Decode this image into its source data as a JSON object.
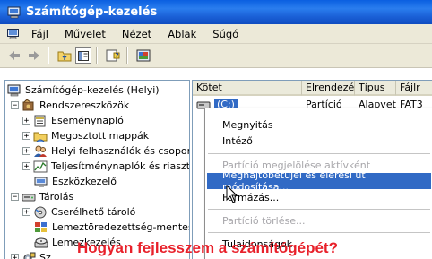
{
  "window": {
    "title": "Számítógép-kezelés"
  },
  "menubar": {
    "items": [
      "Fájl",
      "Művelet",
      "Nézet",
      "Ablak",
      "Súgó"
    ]
  },
  "toolbar": {
    "buttons": [
      "back-icon",
      "forward-icon",
      "up-folder-icon",
      "show-hide-tree-icon",
      "help-icon",
      "properties-icon"
    ]
  },
  "tree": {
    "root": "Számítógép-kezelés (Helyi)",
    "nodes": [
      {
        "label": "Rendszereszközök"
      },
      {
        "label": "Eseménynapló"
      },
      {
        "label": "Megosztott mappák"
      },
      {
        "label": "Helyi felhasználók és csoport"
      },
      {
        "label": "Teljesítménynaplók és riasztá"
      },
      {
        "label": "Eszközkezelő"
      },
      {
        "label": "Tárolás"
      },
      {
        "label": "Cserélhető tároló"
      },
      {
        "label": "Lemeztöredezettség-mentes"
      },
      {
        "label": "Lemezkezelés"
      },
      {
        "label": "Sz"
      }
    ]
  },
  "list": {
    "columns": [
      "Kötet",
      "Elrendezés",
      "Típus",
      "Fájlr"
    ],
    "rows": [
      {
        "volume": "(C:)",
        "layout": "Partíció",
        "type": "Alapvető",
        "fs": "FAT3"
      }
    ]
  },
  "context_menu": {
    "items": [
      {
        "label": "Megnyitás",
        "enabled": true,
        "highlighted": false
      },
      {
        "label": "Intéző",
        "enabled": true,
        "highlighted": false
      },
      {
        "label": "Partíció megjelölése aktívként",
        "enabled": false,
        "highlighted": false
      },
      {
        "label": "Meghajtóbetűjel és elérési út módosítása...",
        "enabled": true,
        "highlighted": true
      },
      {
        "label": "Formázás...",
        "enabled": true,
        "highlighted": false
      },
      {
        "label": "Partíció törlése...",
        "enabled": false,
        "highlighted": false
      },
      {
        "label": "Tulajdonságok",
        "enabled": true,
        "highlighted": false
      }
    ]
  },
  "caption": {
    "text": "Hogyan fejlesszem a számítógépét?"
  },
  "colors": {
    "titlebar": "#0a5fe0",
    "highlight": "#316ac5",
    "caption": "#e8202a",
    "chrome": "#ece9d8"
  }
}
